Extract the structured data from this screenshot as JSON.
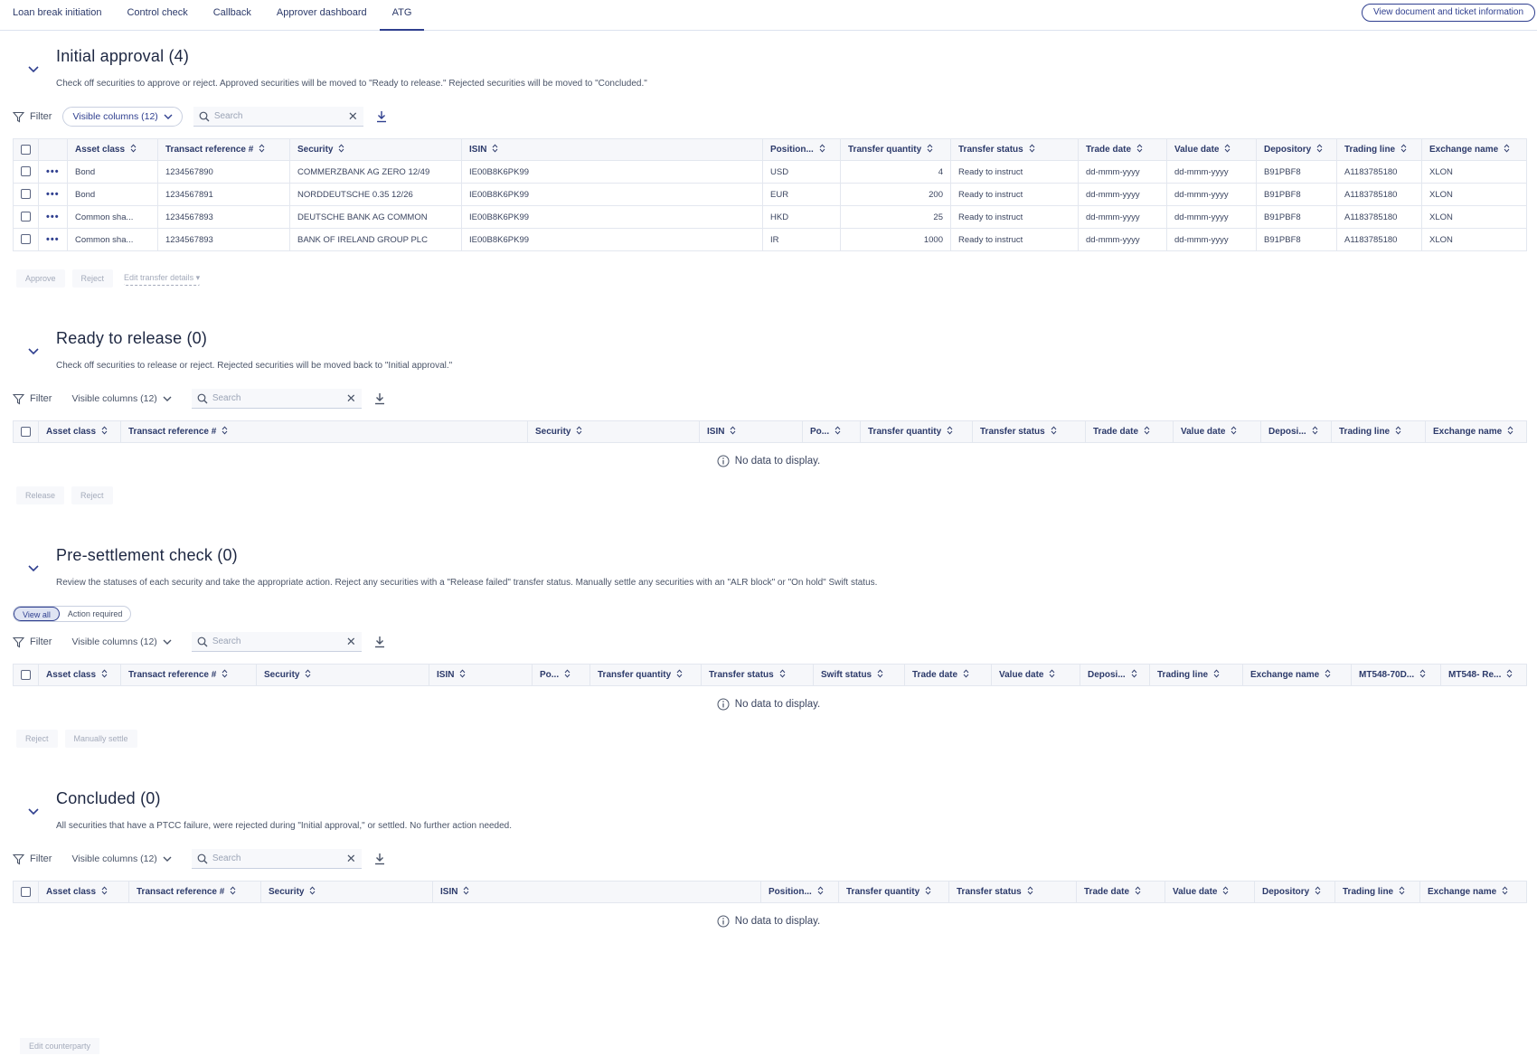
{
  "tabs": [
    {
      "label": "Loan break initiation",
      "active": false
    },
    {
      "label": "Control check",
      "active": false
    },
    {
      "label": "Callback",
      "active": false
    },
    {
      "label": "Approver dashboard",
      "active": false
    },
    {
      "label": "ATG",
      "active": true
    }
  ],
  "top_button": "View document and ticket information",
  "common": {
    "filter_label": "Filter",
    "visible_columns": "Visible columns (12)",
    "search_placeholder": "Search",
    "no_data": "No data to display."
  },
  "initial_approval": {
    "title": "Initial approval (4)",
    "description": "Check off securities to approve or reject. Approved securities will be moved to \"Ready to release.\" Rejected securities will be moved to \"Concluded.\"",
    "columns": [
      "Asset class",
      "Transact reference #",
      "Security",
      "ISIN",
      "Position...",
      "Transfer quantity",
      "Transfer status",
      "Trade date",
      "Value date",
      "Depository",
      "Trading line",
      "Exchange name"
    ],
    "rows": [
      [
        "Bond",
        "1234567890",
        "COMMERZBANK AG ZERO 12/49",
        "IE00B8K6PK99",
        "USD",
        "4",
        "Ready to instruct",
        "dd-mmm-yyyy",
        "dd-mmm-yyyy",
        "B91PBF8",
        "A1183785180",
        "XLON"
      ],
      [
        "Bond",
        "1234567891",
        "NORDDEUTSCHE 0.35 12/26",
        "IE00B8K6PK99",
        "EUR",
        "200",
        "Ready to instruct",
        "dd-mmm-yyyy",
        "dd-mmm-yyyy",
        "B91PBF8",
        "A1183785180",
        "XLON"
      ],
      [
        "Common sha...",
        "1234567893",
        "DEUTSCHE BANK AG COMMON",
        "IE00B8K6PK99",
        "HKD",
        "25",
        "Ready to instruct",
        "dd-mmm-yyyy",
        "dd-mmm-yyyy",
        "B91PBF8",
        "A1183785180",
        "XLON"
      ],
      [
        "Common sha...",
        "1234567893",
        "BANK OF IRELAND GROUP PLC",
        "IE00B8K6PK99",
        "IR",
        "1000",
        "Ready to instruct",
        "dd-mmm-yyyy",
        "dd-mmm-yyyy",
        "B91PBF8",
        "A1183785180",
        "XLON"
      ]
    ],
    "actions": [
      "Approve",
      "Reject"
    ],
    "edit_link": "Edit transfer details ▾"
  },
  "ready_to_release": {
    "title": "Ready to release (0)",
    "description": "Check off securities to release or reject. Rejected securities will be moved back to \"Initial approval.\"",
    "columns": [
      "Asset class",
      "Transact reference #",
      "Security",
      "ISIN",
      "Po...",
      "Transfer quantity",
      "Transfer status",
      "Trade date",
      "Value date",
      "Deposi...",
      "Trading line",
      "Exchange name"
    ],
    "actions": [
      "Release",
      "Reject"
    ]
  },
  "pre_settlement": {
    "title": "Pre-settlement check (0)",
    "description": "Review the statuses of each security and take the appropriate action. Reject any securities with a \"Release failed\" transfer status. Manually settle any securities with an \"ALR block\" or \"On hold\" Swift status.",
    "segments": [
      "View all",
      "Action required"
    ],
    "columns": [
      "Asset class",
      "Transact reference #",
      "Security",
      "ISIN",
      "Po...",
      "Transfer quantity",
      "Transfer status",
      "Swift status",
      "Trade date",
      "Value date",
      "Deposi...",
      "Trading line",
      "Exchange name",
      "MT548-70D...",
      "MT548- Re..."
    ],
    "actions": [
      "Reject",
      "Manually settle"
    ]
  },
  "concluded": {
    "title": "Concluded (0)",
    "description": "All securities that have a PTCC failure, were rejected during \"Initial approval,\" or settled. No further action needed.",
    "columns": [
      "Asset class",
      "Transact reference #",
      "Security",
      "ISIN",
      "Position...",
      "Transfer quantity",
      "Transfer status",
      "Trade date",
      "Value date",
      "Depository",
      "Trading line",
      "Exchange name"
    ]
  },
  "bottom_button": "Edit counterparty"
}
